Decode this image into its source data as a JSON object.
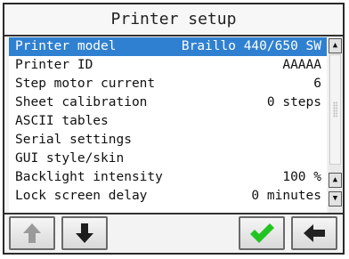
{
  "title": "Printer setup",
  "menu": {
    "items": [
      {
        "label": "Printer model",
        "value": "Braillo 440/650 SW"
      },
      {
        "label": "Printer ID",
        "value": "AAAAA"
      },
      {
        "label": "Step motor current",
        "value": "6"
      },
      {
        "label": "Sheet calibration",
        "value": "0 steps"
      },
      {
        "label": "ASCII tables",
        "value": ""
      },
      {
        "label": "Serial settings",
        "value": ""
      },
      {
        "label": "GUI style/skin",
        "value": ""
      },
      {
        "label": "Backlight intensity",
        "value": "100 %"
      },
      {
        "label": "Lock screen delay",
        "value": "0 minutes"
      }
    ],
    "selected_index": 0
  },
  "scrollbar": {
    "up_icon": "triangle-up-icon",
    "down_icon": "triangle-down-icon"
  },
  "buttons": {
    "up": {
      "icon": "arrow-up-icon",
      "enabled": false
    },
    "down": {
      "icon": "arrow-down-icon",
      "enabled": true
    },
    "confirm": {
      "icon": "checkmark-icon",
      "color": "#22c422"
    },
    "back": {
      "icon": "arrow-left-icon",
      "color": "#222222"
    }
  },
  "colors": {
    "selection": "#2f80d0",
    "selection_text": "#ffffff"
  }
}
